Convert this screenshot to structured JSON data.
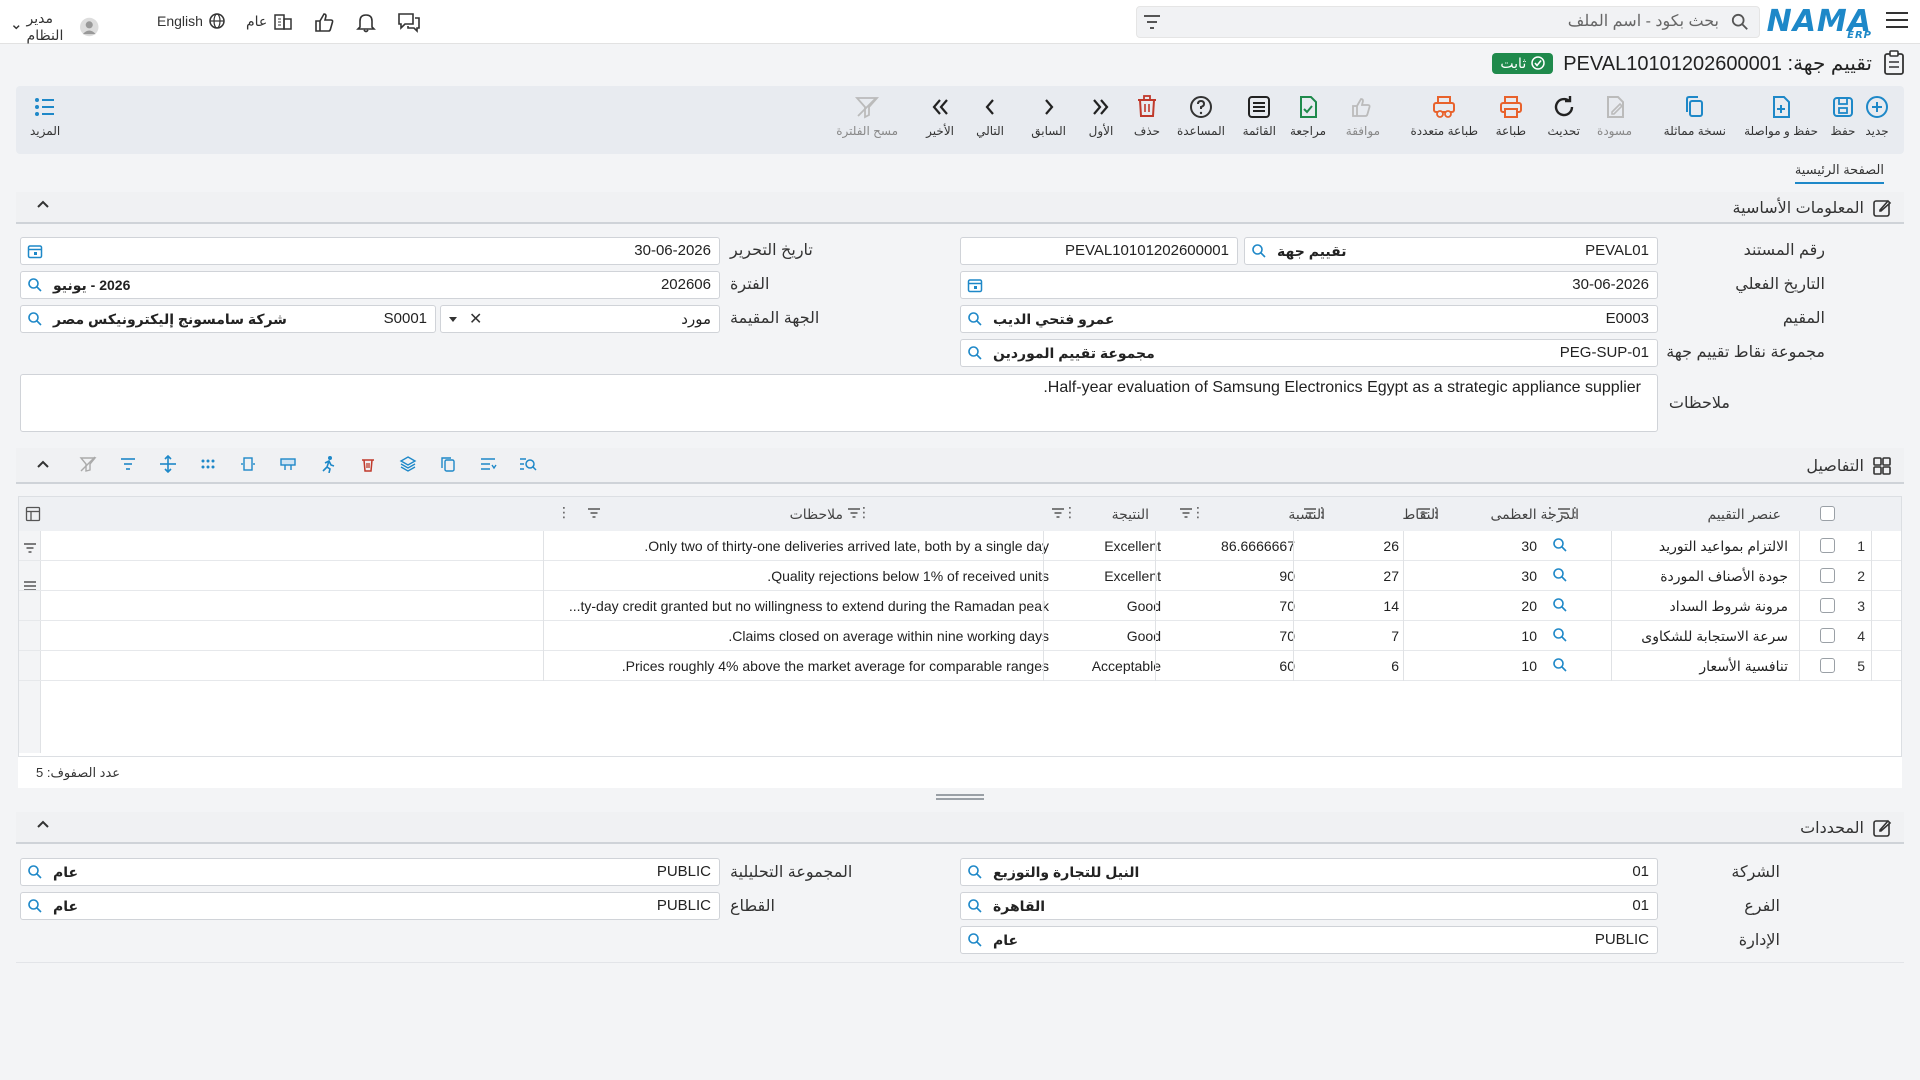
{
  "topbar": {
    "logo": "NAMA",
    "logo_sub": "ERP",
    "search_placeholder": "بحث بكود - اسم الملف",
    "user": "مدير النظام",
    "language": "English",
    "scope": "عام"
  },
  "title": {
    "text": "تقييم جهة: PEVAL10101202600001",
    "status": "ثابت"
  },
  "toolbar": {
    "new": "جديد",
    "save": "حفظ",
    "save_continue": "حفظ و مواصلة",
    "copy": "نسخة مماثلة",
    "draft": "مسودة",
    "refresh": "تحديث",
    "print": "طباعة",
    "multi_print": "طباعة متعددة",
    "approve": "موافقة",
    "review": "مراجعة",
    "list": "القائمة",
    "help": "المساعدة",
    "delete": "حذف",
    "first": "الأول",
    "previous": "السابق",
    "next": "التالي",
    "last": "الأخير",
    "clear_filter": "مسح الفلترة",
    "more": "المزيد"
  },
  "tabs": {
    "home": "الصفحة الرئيسية"
  },
  "sections": {
    "basic": "المعلومات الأساسية",
    "details": "التفاصيل",
    "dimensions": "المحددات"
  },
  "form": {
    "doc_no_label": "رقم المستند",
    "doc_no_code": "PEVAL01",
    "doc_no_type": "تقييم جهة",
    "doc_no_value": "PEVAL10101202600001",
    "edit_date_label": "تاريخ التحرير",
    "edit_date": "30-06-2026",
    "actual_date_label": "التاريخ الفعلي",
    "actual_date": "30-06-2026",
    "period_label": "الفترة",
    "period_code": "202606",
    "period_desc": "2026 - يونيو",
    "evaluator_label": "المقيم",
    "evaluator_code": "E0003",
    "evaluator_name": "عمرو فتحي الديب",
    "evaluated_label": "الجهة المقيمة",
    "evaluated_type": "مورد",
    "evaluated_code": "S0001",
    "evaluated_name": "شركة سامسونج إليكترونيكس مصر",
    "points_group_label": "مجموعة نقاط تقييم جهة",
    "points_group_code": "PEG-SUP-01",
    "points_group_name": "مجموعة تقييم الموردين",
    "notes_label": "ملاحظات",
    "notes_value": "Half-year evaluation of Samsung Electronics Egypt as a strategic appliance supplier."
  },
  "grid": {
    "headers": {
      "item": "عنصر التقييم",
      "max": "الدرجة العظمى",
      "points": "النقاط",
      "ratio": "النسبة",
      "result": "النتيجة",
      "notes": "ملاحظات"
    },
    "rows": [
      {
        "n": "1",
        "item": "الالتزام بمواعيد التوريد",
        "max": "30",
        "points": "26",
        "ratio": "86.6666667",
        "result": "Excellent",
        "notes": "Only two of thirty-one deliveries arrived late, both by a single day."
      },
      {
        "n": "2",
        "item": "جودة الأصناف الموردة",
        "max": "30",
        "points": "27",
        "ratio": "90",
        "result": "Excellent",
        "notes": "Quality rejections below 1% of received units."
      },
      {
        "n": "3",
        "item": "مرونة شروط السداد",
        "max": "20",
        "points": "14",
        "ratio": "70",
        "result": "Good",
        "notes": "...ty-day credit granted but no willingness to extend during the Ramadan peak"
      },
      {
        "n": "4",
        "item": "سرعة الاستجابة للشكاوى",
        "max": "10",
        "points": "7",
        "ratio": "70",
        "result": "Good",
        "notes": "Claims closed on average within nine working days."
      },
      {
        "n": "5",
        "item": "تنافسية الأسعار",
        "max": "10",
        "points": "6",
        "ratio": "60",
        "result": "Acceptable",
        "notes": "Prices roughly 4% above the market average for comparable ranges."
      }
    ],
    "row_count": "عدد الصفوف: 5"
  },
  "dimensions": {
    "company_label": "الشركة",
    "company_code": "01",
    "company_name": "النيل للتجارة والتوزيع",
    "branch_label": "الفرع",
    "branch_code": "01",
    "branch_name": "القاهرة",
    "dept_label": "الإدارة",
    "dept_code": "PUBLIC",
    "dept_name": "عام",
    "analytic_label": "المجموعة التحليلية",
    "analytic_code": "PUBLIC",
    "analytic_name": "عام",
    "sector_label": "القطاع",
    "sector_code": "PUBLIC",
    "sector_name": "عام"
  },
  "colors": {
    "accent": "#1e88c8",
    "status_green": "#1f8a4c",
    "print_orange": "#e8622c",
    "delete_red": "#c0392b"
  }
}
